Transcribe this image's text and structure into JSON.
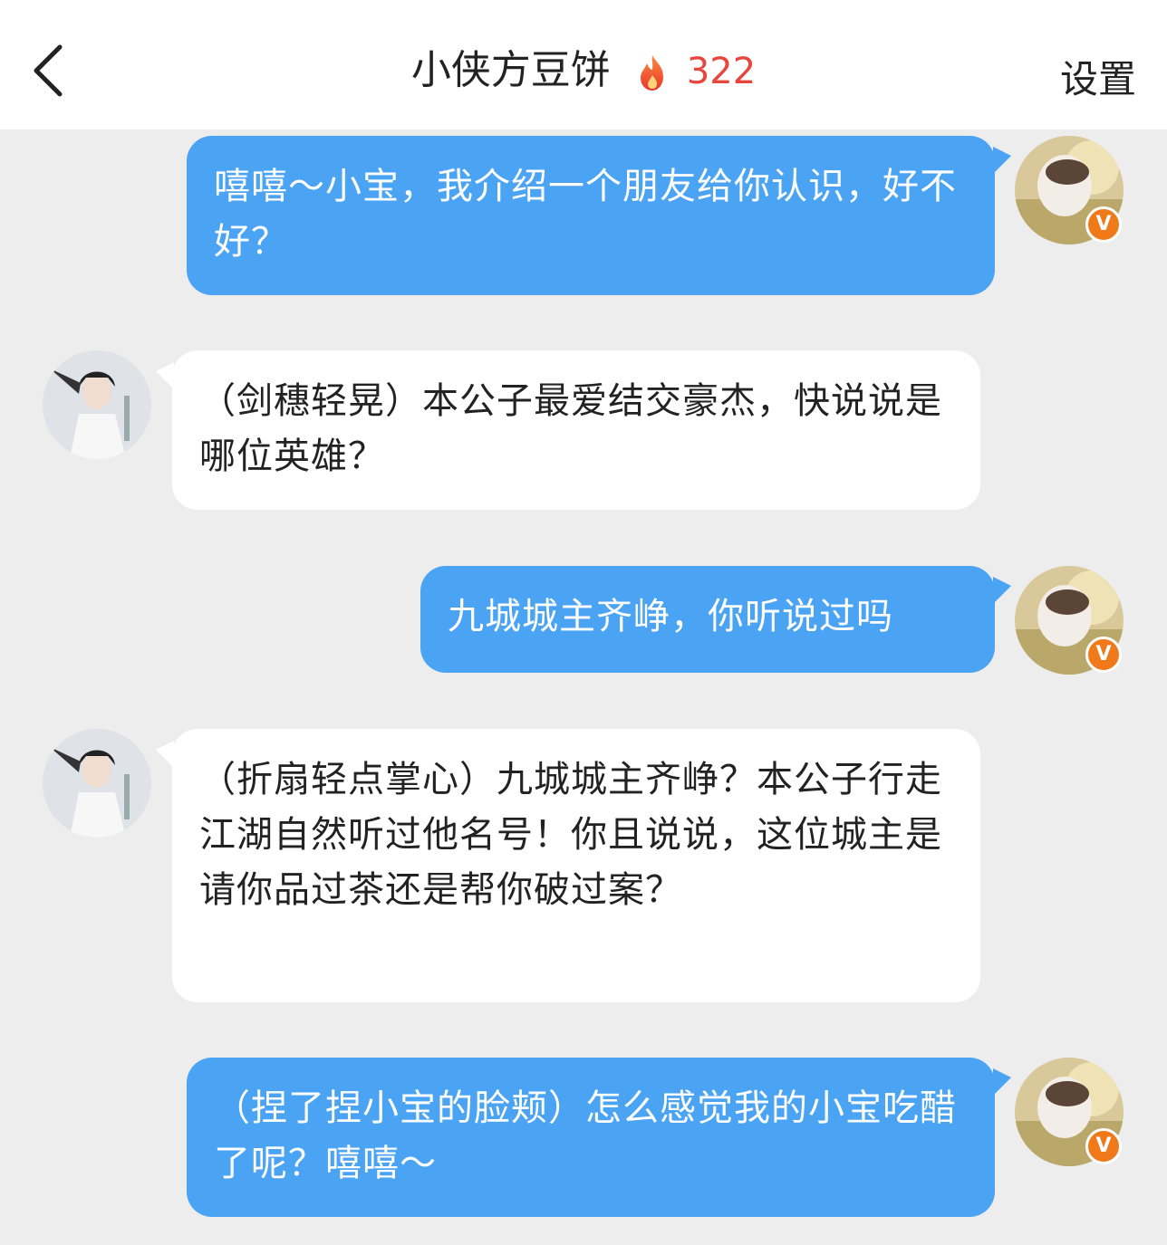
{
  "header": {
    "back_icon": "chevron-left-icon",
    "title": "小侠方豆饼",
    "flame_icon": "flame-icon",
    "count": "322",
    "settings_label": "设置"
  },
  "colors": {
    "user_bubble": "#4aa3f3",
    "bot_bubble": "#ffffff",
    "count": "#e8453c",
    "badge": "#f07a1a"
  },
  "messages": [
    {
      "sender": "user",
      "text": "嘻嘻～小宝，我介绍一个朋友给你认识，好不好？"
    },
    {
      "sender": "bot",
      "text": "（剑穗轻晃）本公子最爱结交豪杰，快说说是哪位英雄？"
    },
    {
      "sender": "user",
      "text": "九城城主齐峥，你听说过吗"
    },
    {
      "sender": "bot",
      "text": "（折扇轻点掌心）九城城主齐峥？本公子行走江湖自然听过他名号！你且说说，这位城主是请你品过茶还是帮你破过案？"
    },
    {
      "sender": "user",
      "text": "（捏了捏小宝的脸颊）怎么感觉我的小宝吃醋了呢？嘻嘻～"
    }
  ],
  "verified_badge": "V"
}
